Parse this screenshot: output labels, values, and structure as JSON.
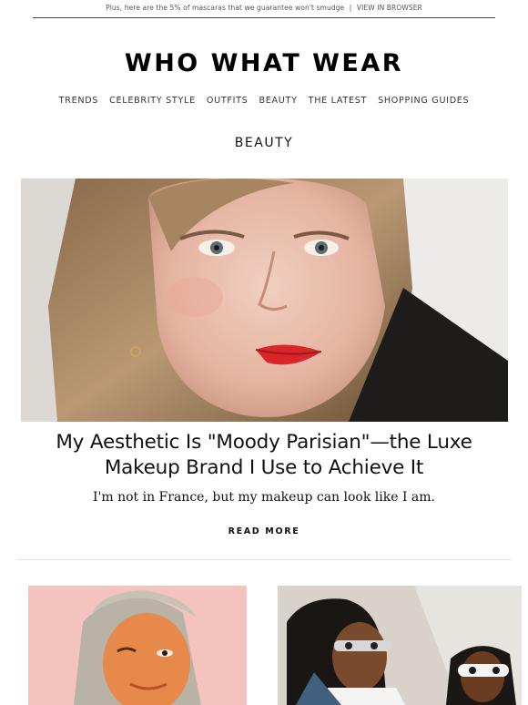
{
  "preheader": {
    "text": "Plus, here are the 5% of mascaras that we guarantee won't smudge",
    "separator": "|",
    "link": "VIEW IN BROWSER"
  },
  "brand": {
    "logo": "WHO WHAT WEAR"
  },
  "nav": {
    "items": [
      "TRENDS",
      "CELEBRITY STYLE",
      "OUTFITS",
      "BEAUTY",
      "THE LATEST",
      "SHOPPING GUIDES"
    ]
  },
  "section": {
    "title": "BEAUTY"
  },
  "feature": {
    "headline": "My Aesthetic Is \"Moody Parisian\"—the Luxe Makeup Brand I Use to Achieve It",
    "subhead": "I'm not in France, but my makeup can look like I am.",
    "cta": "READ MORE"
  }
}
